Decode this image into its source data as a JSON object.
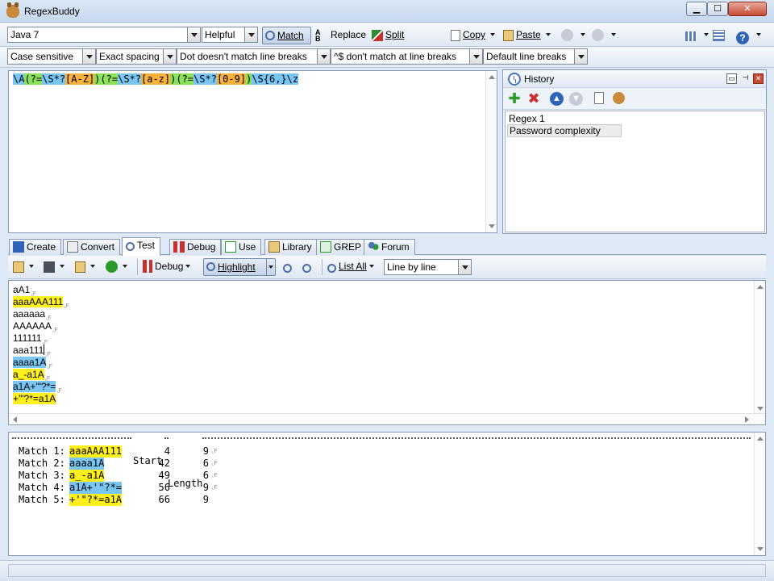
{
  "window": {
    "title": "RegexBuddy"
  },
  "toolbar_main": {
    "flavor": "Java 7",
    "helpful": "Helpful",
    "match": "Match",
    "replace": "Replace",
    "split": "Split",
    "copy": "Copy",
    "paste": "Paste"
  },
  "options": {
    "case": "Case sensitive",
    "spacing": "Exact spacing",
    "dot": "Dot doesn't match line breaks",
    "caret": "^$ don't match at line breaks",
    "linebreaks": "Default line breaks"
  },
  "regex": {
    "tokens": [
      {
        "t": "\\A",
        "c": "anchor"
      },
      {
        "t": "(?=",
        "c": "group"
      },
      {
        "t": "\\S*?",
        "c": "quant"
      },
      {
        "t": "[A-Z]",
        "c": "class"
      },
      {
        "t": ")",
        "c": "group"
      },
      {
        "t": "(?=",
        "c": "group"
      },
      {
        "t": "\\S*?",
        "c": "quant"
      },
      {
        "t": "[a-z]",
        "c": "class"
      },
      {
        "t": ")",
        "c": "group"
      },
      {
        "t": "(?=",
        "c": "group"
      },
      {
        "t": "\\S*?",
        "c": "quant"
      },
      {
        "t": "[0-9]",
        "c": "class"
      },
      {
        "t": ")",
        "c": "group"
      },
      {
        "t": "\\S{6,}",
        "c": "quant"
      },
      {
        "t": "\\z",
        "c": "anchor"
      }
    ]
  },
  "history": {
    "title": "History",
    "items": [
      "Regex 1",
      "Password complexity"
    ]
  },
  "tabs": [
    "Create",
    "Convert",
    "Test",
    "Debug",
    "Use",
    "Library",
    "GREP",
    "Forum"
  ],
  "test_toolbar": {
    "debug": "Debug",
    "highlight": "Highlight",
    "list_all": "List All",
    "mode": "Line by line"
  },
  "test_lines": [
    {
      "text": "aA1",
      "hl": ""
    },
    {
      "text": "aaaAAA111",
      "hl": "yellow"
    },
    {
      "text": "aaaaaa",
      "hl": ""
    },
    {
      "text": "AAAAAA",
      "hl": ""
    },
    {
      "text": "111111",
      "hl": ""
    },
    {
      "text": "aaa111",
      "hl": "",
      "caret": true
    },
    {
      "text": "aaaa1A",
      "hl": "blue"
    },
    {
      "text": "a_-a1A",
      "hl": "yellow"
    },
    {
      "text": "a1A+'\"?*=",
      "hl": "blue"
    },
    {
      "text": "+'\"?*=a1A",
      "hl": "yellow",
      "last": true
    }
  ],
  "results": {
    "header_start": "Start",
    "header_length": "Length",
    "rows": [
      {
        "label": "Match 1:",
        "text": "aaaAAA111",
        "hl": "yellow",
        "start": "4",
        "length": "9"
      },
      {
        "label": "Match 2:",
        "text": "aaaa1A",
        "hl": "blue",
        "start": "42",
        "length": "6"
      },
      {
        "label": "Match 3:",
        "text": "a_-a1A",
        "hl": "yellow",
        "start": "49",
        "length": "6"
      },
      {
        "label": "Match 4:",
        "text": "a1A+'\"?*=",
        "hl": "blue",
        "start": "56",
        "length": "9"
      },
      {
        "label": "Match 5:",
        "text": "+'\"?*=a1A",
        "hl": "yellow",
        "start": "66",
        "length": "9"
      }
    ]
  }
}
